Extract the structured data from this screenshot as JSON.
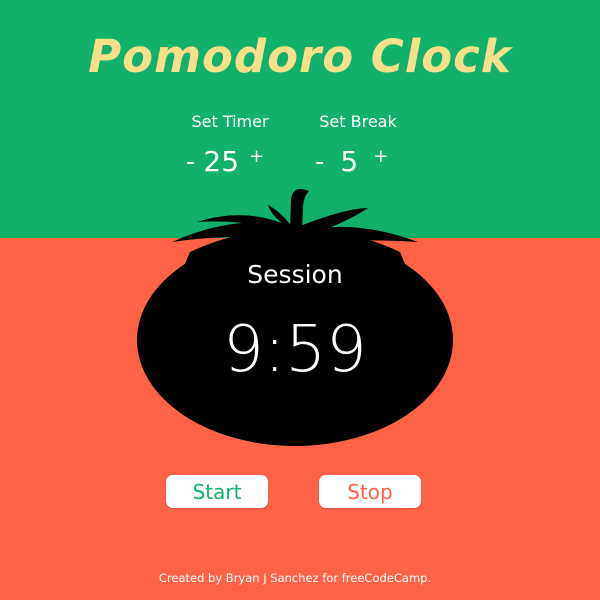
{
  "app": {
    "title": "Pomodoro Clock"
  },
  "settings": {
    "timer": {
      "label": "Set Timer",
      "decrement": "-",
      "value": "25",
      "increment": "+"
    },
    "break": {
      "label": "Set Break",
      "decrement": "-",
      "value": "5",
      "increment": "+"
    }
  },
  "clock": {
    "mode": "Session",
    "time": "9:59"
  },
  "buttons": {
    "start": "Start",
    "stop": "Stop"
  },
  "footer": {
    "text": "Created by Bryan J Sanchez for freeCodeCamp."
  },
  "colors": {
    "top_background": "#11b16b",
    "bottom_background": "#fe6347",
    "title": "#f8e08a",
    "tomato": "#000000",
    "start_text": "#11b16b",
    "stop_text": "#fe6347"
  },
  "icons": {
    "tomato": "tomato-silhouette-icon"
  }
}
